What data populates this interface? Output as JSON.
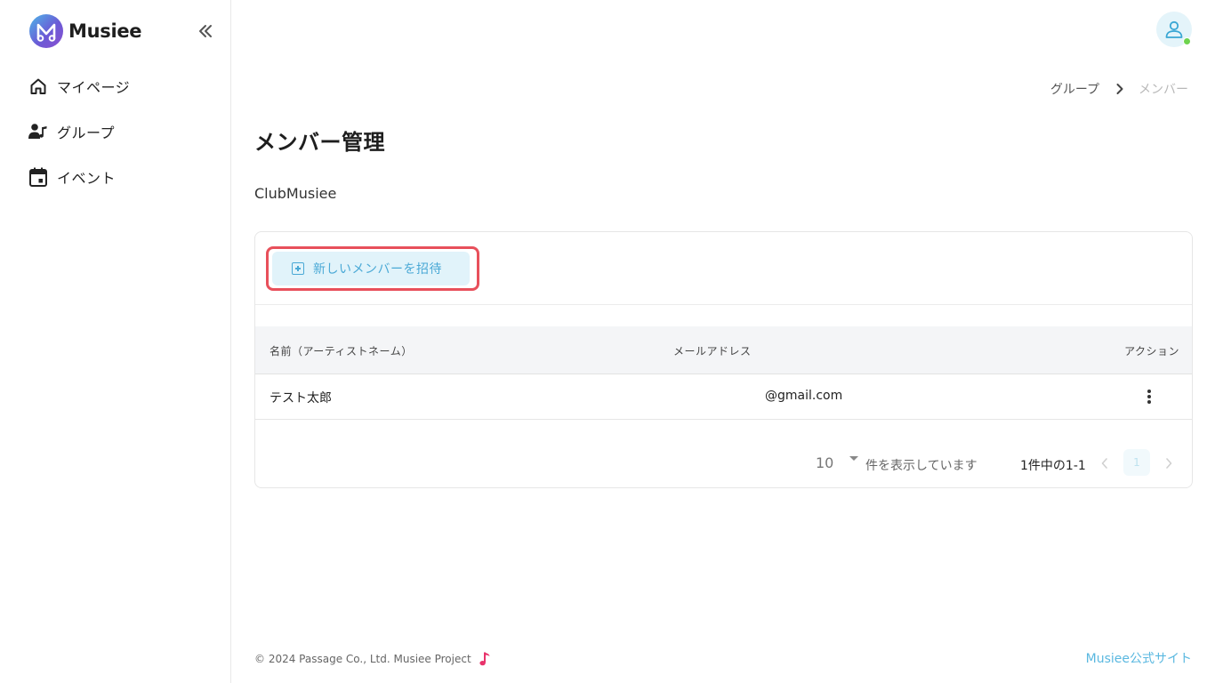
{
  "app": {
    "name": "Musiee",
    "accent_color": "#4aa9d6",
    "highlight_color": "#e8505b"
  },
  "sidebar": {
    "collapse_icon": "double-chevron-left-icon",
    "items": [
      {
        "label": "マイページ",
        "icon": "home-icon"
      },
      {
        "label": "グループ",
        "icon": "group-music-icon"
      },
      {
        "label": "イベント",
        "icon": "calendar-icon"
      }
    ]
  },
  "header": {
    "avatar_icon": "user-icon",
    "status_color": "#6dd34e"
  },
  "breadcrumb": {
    "parent": "グループ",
    "current": "メンバー"
  },
  "main": {
    "title": "メンバー管理",
    "group_name": "ClubMusiee",
    "invite_button": "新しいメンバーを招待",
    "table": {
      "columns": [
        "名前（アーティストネーム）",
        "メールアドレス",
        "アクション"
      ],
      "rows": [
        {
          "name": "テスト太郎",
          "email": "@gmail.com"
        }
      ]
    },
    "pagination": {
      "per_page": "10",
      "per_page_label": "件を表示しています",
      "range": "1件中の1-1",
      "current_page": "1"
    }
  },
  "footer": {
    "copyright": "© 2024 Passage Co., Ltd. Musiee Project",
    "official_link": "Musiee公式サイト"
  }
}
